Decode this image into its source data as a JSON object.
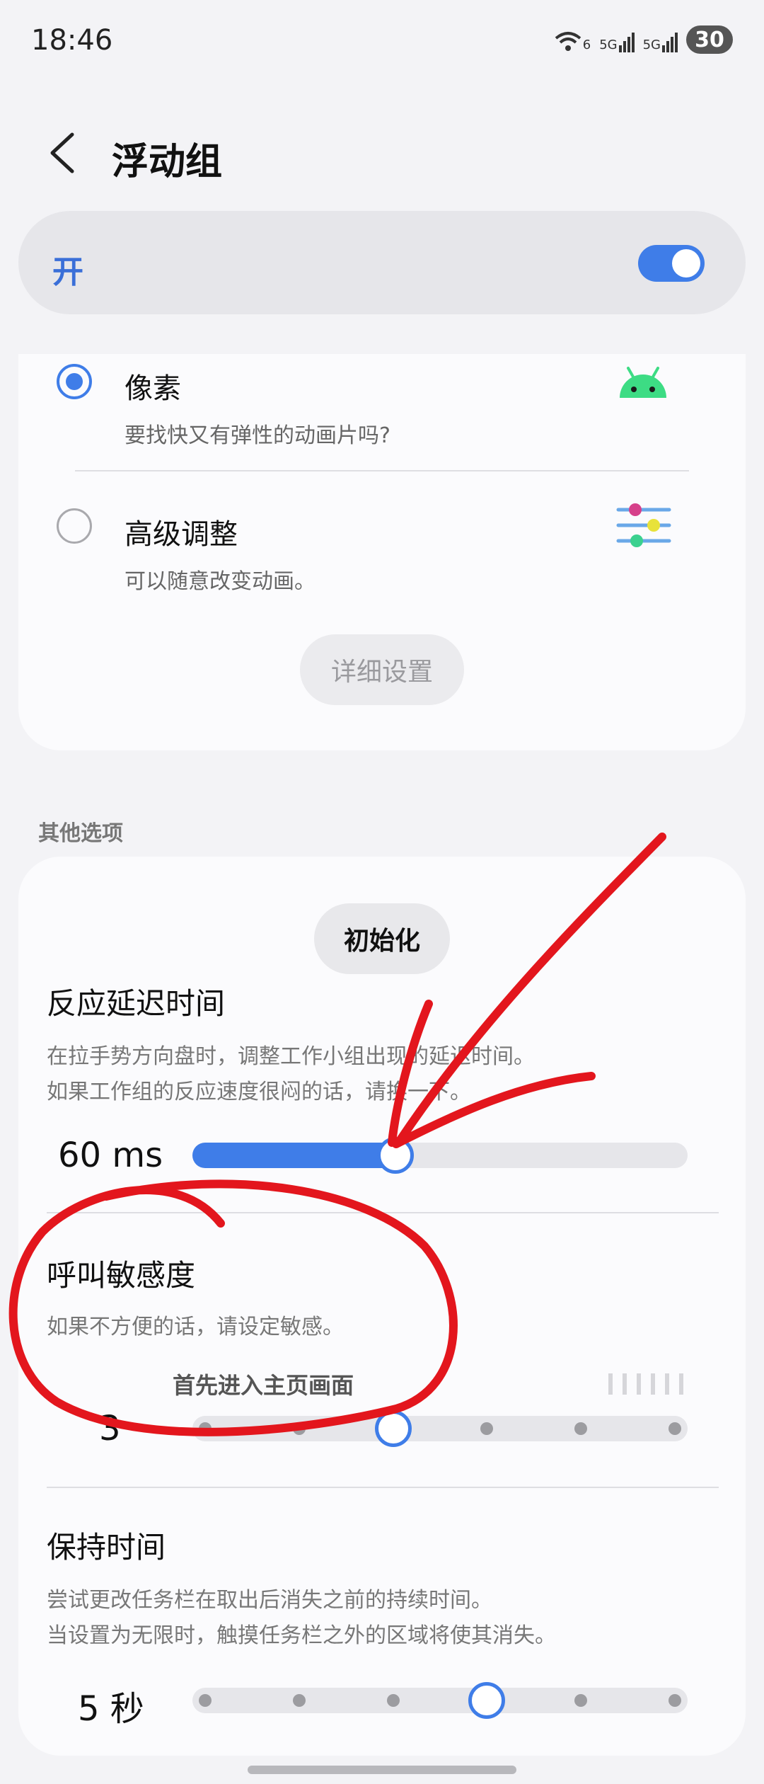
{
  "status_bar": {
    "time": "18:46",
    "wifi_label": "6",
    "sim1_label": "5G",
    "sim2_label": "5G",
    "battery": "30"
  },
  "header": {
    "title": "浮动组"
  },
  "master": {
    "label": "开",
    "on": true
  },
  "options": [
    {
      "title": "像素",
      "subtitle": "要找快又有弹性的动画片吗?",
      "selected": true,
      "icon": "android-icon"
    },
    {
      "title": "高级调整",
      "subtitle": "可以随意改变动画。",
      "selected": false,
      "icon": "sliders-icon"
    }
  ],
  "details_button": "详细设置",
  "section_label": "其他选项",
  "reset_button": "初始化",
  "settings": {
    "delay": {
      "title": "反应延迟时间",
      "desc_line1": "在拉手势方向盘时，调整工作小组出现的延迟时间。",
      "desc_line2": "如果工作组的反应速度很闷的话，请换一下。",
      "value_label": "60 ms",
      "fraction": 0.41
    },
    "sensitivity": {
      "title": "呼叫敏感度",
      "desc": "如果不方便的话，请设定敏感。",
      "overlay_caption": "首先进入主页画面",
      "value_label": "3",
      "steps": 6,
      "current_step": 3
    },
    "duration": {
      "title": "保持时间",
      "desc_line1": "尝试更改任务栏在取出后消失之前的持续时间。",
      "desc_line2": "当设置为无限时，触摸任务栏之外的区域将使其消失。",
      "value_label": "5 秒",
      "steps": 6,
      "current_step": 4
    }
  },
  "colors": {
    "accent": "#3f7de8",
    "annotation": "#e3161d",
    "android_green": "#3ddc84"
  }
}
